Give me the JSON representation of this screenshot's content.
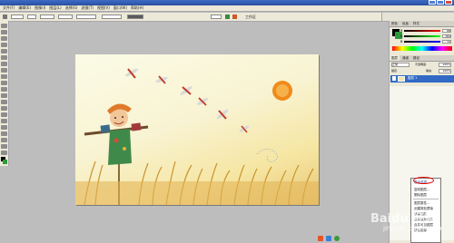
{
  "app": {
    "menu": [
      "文件(F)",
      "编辑(E)",
      "图像(I)",
      "图层(L)",
      "选择(S)",
      "滤镜(T)",
      "视图(V)",
      "窗口(W)",
      "帮助(H)"
    ]
  },
  "options": {
    "workspace_label": "工作区"
  },
  "panels": {
    "color_tabs": [
      "颜色",
      "色板",
      "样式"
    ],
    "sliders": [
      {
        "name": "R",
        "value": "88"
      },
      {
        "name": "G",
        "value": "184"
      },
      {
        "name": "B",
        "value": "72"
      }
    ],
    "layer_tabs": [
      "图层",
      "通道",
      "路径"
    ],
    "blend_mode": "正常",
    "opacity_label": "不透明度:",
    "opacity_value": "100%",
    "lock_label": "锁定:",
    "fill_label": "填充:",
    "fill_value": "100%",
    "layers": [
      "图层 1"
    ]
  },
  "context_menu": {
    "items": [
      "混合选项...",
      "复制图层...",
      "删除图层",
      "",
      "图层属性...",
      "创建剪贴蒙版",
      "链接图层",
      "选择链接图层",
      "合并可见图层",
      "拼合图像"
    ]
  },
  "watermark": {
    "name": "Baidu 经验",
    "url": "jingyan.baidu.com"
  },
  "colors": {
    "accent": "#2a4fa0",
    "highlight": "#e00000"
  }
}
